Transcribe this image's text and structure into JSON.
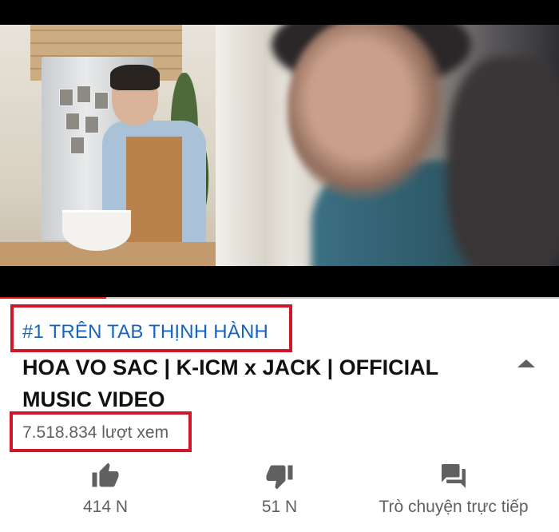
{
  "video": {
    "description": "Music video frame: person cooking in kitchen, blurred smiling face in foreground",
    "progress_fraction": 0.19
  },
  "trending_label": "#1 TRÊN TAB THỊNH HÀNH",
  "title": "HOA VO SAC | K-ICM x JACK | OFFICIAL MUSIC VIDEO",
  "views": "7.518.834 lượt xem",
  "actions": {
    "like": {
      "count": "414 N",
      "icon": "thumbs-up-icon"
    },
    "dislike": {
      "count": "51 N",
      "icon": "thumbs-down-icon"
    },
    "chat": {
      "label": "Trò chuyện trực tiếp",
      "icon": "chat-icon"
    }
  },
  "colors": {
    "trending": "#1565c0",
    "highlight_box": "#d0162a",
    "progress": "#e62117",
    "secondary_text": "#606060"
  }
}
